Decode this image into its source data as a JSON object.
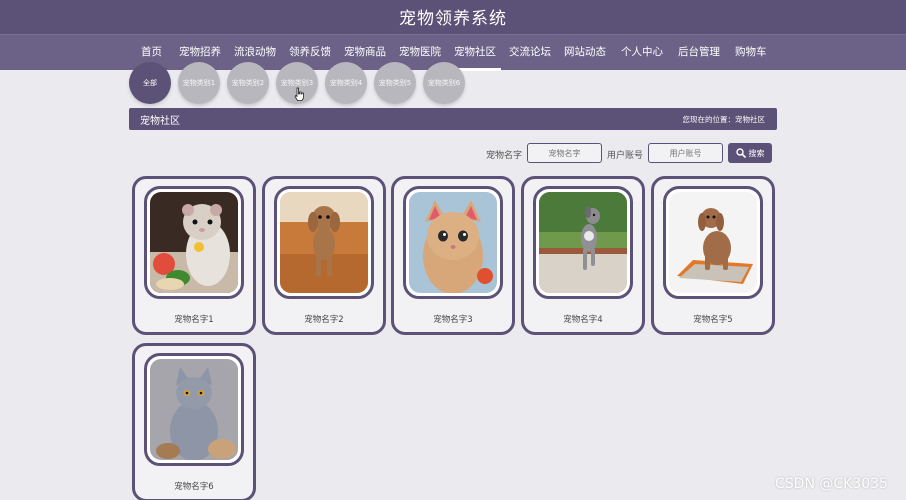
{
  "site_title": "宠物领养系统",
  "nav": {
    "items": [
      "首页",
      "宠物招养",
      "流浪动物",
      "领养反馈",
      "宠物商品",
      "宠物医院",
      "宠物社区",
      "交流论坛",
      "网站动态",
      "个人中心",
      "后台管理",
      "购物车"
    ],
    "active_index": 6
  },
  "categories": {
    "items": [
      "全部",
      "宠物类别1",
      "宠物类别2",
      "宠物类别3",
      "宠物类别4",
      "宠物类别5",
      "宠物类别6"
    ],
    "active_index": 0
  },
  "section": {
    "title": "宠物社区",
    "location": "您现在的位置：宠物社区"
  },
  "search": {
    "name_label": "宠物名字",
    "name_placeholder": "宠物名字",
    "account_label": "用户账号",
    "account_placeholder": "用户账号",
    "button_label": "搜索"
  },
  "pets": [
    {
      "name": "宠物名字1",
      "image": "hamster"
    },
    {
      "name": "宠物名字2",
      "image": "poodle-sofa"
    },
    {
      "name": "宠物名字3",
      "image": "kitten-ears"
    },
    {
      "name": "宠物名字4",
      "image": "dog-grass"
    },
    {
      "name": "宠物名字5",
      "image": "poodle-mat"
    },
    {
      "name": "宠物名字6",
      "image": "gray-cat"
    }
  ],
  "watermark": "CSDN @CK3035",
  "colors": {
    "primary": "#5c5176",
    "nav": "#6c6287",
    "background": "#ebebef",
    "inactive_category": "#b8b7bd"
  }
}
